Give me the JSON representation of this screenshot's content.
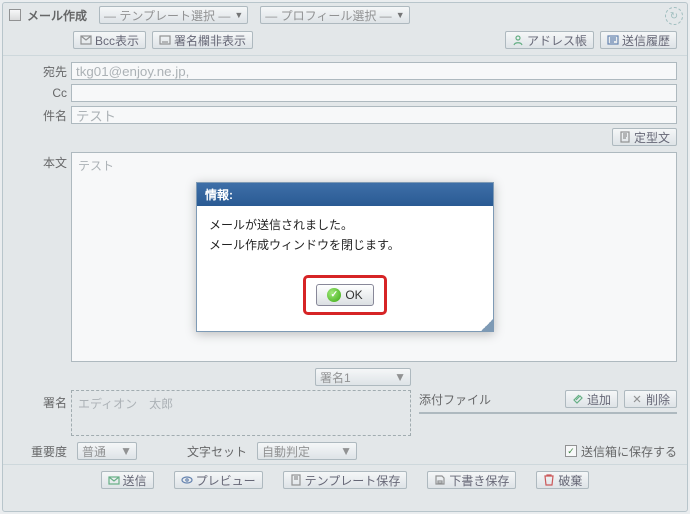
{
  "window": {
    "title": "メール作成",
    "template_select": "― テンプレート選択 ―",
    "profile_select": "― プロフィール選択 ―"
  },
  "toolbar": {
    "bcc_show": "Bcc表示",
    "hide_sig_field": "署名欄非表示",
    "address_book": "アドレス帳",
    "send_history": "送信履歴"
  },
  "labels": {
    "to": "宛先",
    "cc": "Cc",
    "subject": "件名",
    "body": "本文",
    "fixed_text": "定型文",
    "signature": "署名",
    "attachment": "添付ファイル",
    "add": "追加",
    "delete": "削除",
    "priority": "重要度",
    "charset": "文字セット",
    "save_sent": "送信箱に保存する"
  },
  "fields": {
    "to": "tkg01@enjoy.ne.jp,",
    "cc": "",
    "subject": "テスト",
    "body_text": "テスト",
    "signature_select": "署名1",
    "signature_text": "エディオン　太郎",
    "priority_value": "普通",
    "charset_value": "自動判定",
    "save_sent_checked": true
  },
  "actions": {
    "send": "送信",
    "preview": "プレビュー",
    "save_template": "テンプレート保存",
    "save_draft": "下書き保存",
    "discard": "破棄"
  },
  "modal": {
    "title": "情報:",
    "line1": "メールが送信されました。",
    "line2": "メール作成ウィンドウを閉じます。",
    "ok": "OK"
  }
}
